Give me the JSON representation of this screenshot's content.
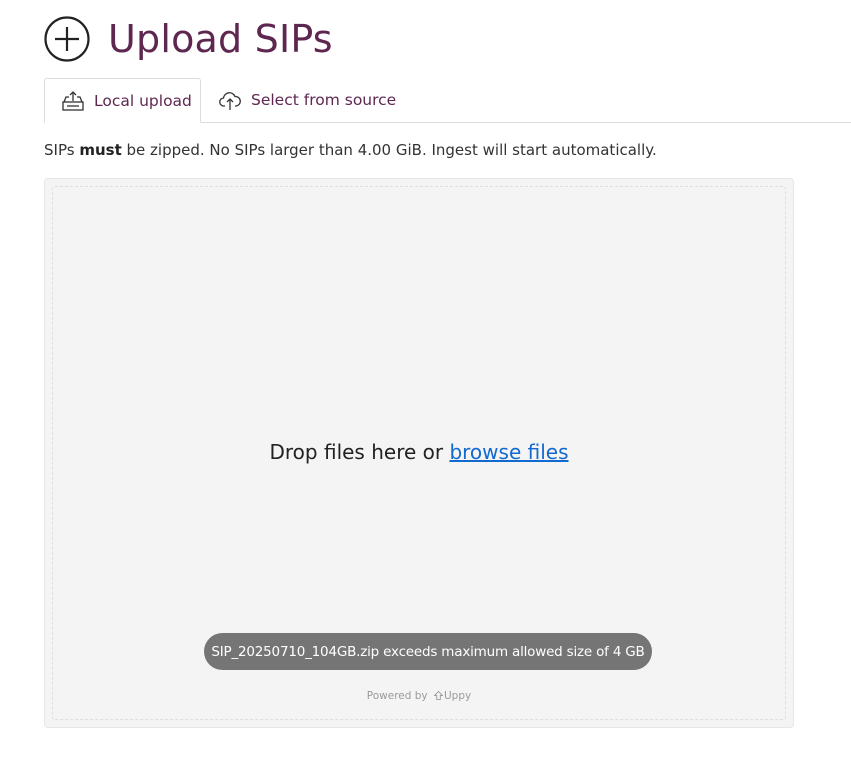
{
  "header": {
    "title": "Upload SIPs",
    "icon": "circle-plus-icon"
  },
  "tabs": [
    {
      "label": "Local upload",
      "icon": "upload-tray-icon",
      "active": true
    },
    {
      "label": "Select from source",
      "icon": "cloud-upload-icon",
      "active": false
    }
  ],
  "notice": {
    "prefix": "SIPs",
    "emphasis": "must",
    "suffix": "be zipped. No SIPs larger than 4.00 GiB. Ingest will start automatically."
  },
  "dropzone": {
    "drop_text": "Drop files here or",
    "browse_label": "browse files",
    "error_toast": "SIP_20250710_104GB.zip exceeds maximum allowed size of 4 GB",
    "powered_by": "Powered by",
    "brand": "Uppy"
  },
  "colors": {
    "brand_purple": "#5e2750",
    "link_blue": "#1269cf",
    "toast_bg": "#757575",
    "dropzone_bg": "#f4f4f4"
  }
}
